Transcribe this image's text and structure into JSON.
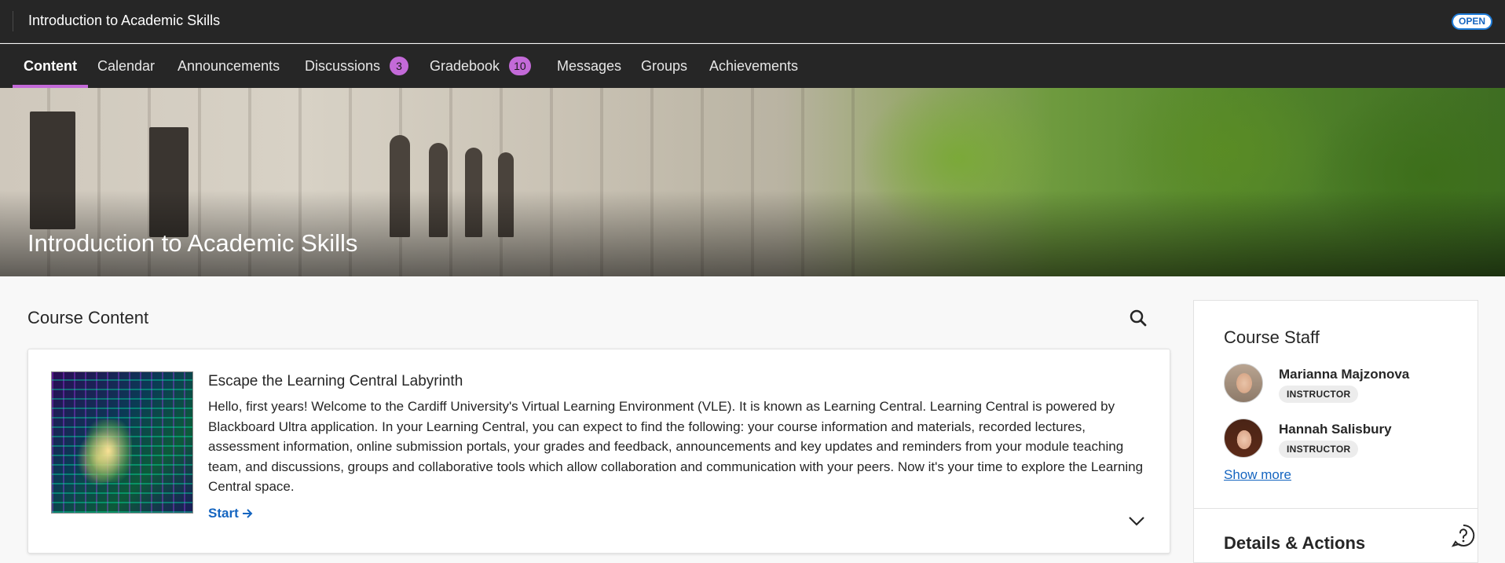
{
  "header": {
    "course_title": "Introduction to Academic Skills",
    "status_badge": "OPEN"
  },
  "nav": {
    "tabs": [
      {
        "label": "Content",
        "active": true
      },
      {
        "label": "Calendar"
      },
      {
        "label": "Announcements"
      },
      {
        "label": "Discussions",
        "badge": "3"
      },
      {
        "label": "Gradebook",
        "badge": "10"
      },
      {
        "label": "Messages"
      },
      {
        "label": "Groups"
      },
      {
        "label": "Achievements"
      }
    ]
  },
  "banner": {
    "title": "Introduction to Academic Skills"
  },
  "main": {
    "section_title": "Course Content",
    "item": {
      "title": "Escape the Learning Central Labyrinth",
      "description": "Hello, first years! Welcome to the Cardiff University's Virtual Learning Environment (VLE). It is known as Learning Central. Learning Central is powered by Blackboard Ultra application. In your Learning Central, you can expect to find the following: your course information and materials, recorded lectures, assessment information, online submission portals, your grades and feedback, announcements and key updates and reminders from your module teaching team, and discussions, groups and collaborative tools which allow collaboration and communication with your peers. Now it's your time to explore the Learning Central space.",
      "start_label": "Start"
    }
  },
  "sidebar": {
    "staff_title": "Course Staff",
    "staff": [
      {
        "name": "Marianna Majzonova",
        "role": "INSTRUCTOR"
      },
      {
        "name": "Hannah Salisbury",
        "role": "INSTRUCTOR"
      }
    ],
    "show_more_label": "Show more",
    "details_title": "Details & Actions"
  },
  "colors": {
    "nav_bg": "#262626",
    "accent_purple": "#c36ad8",
    "link_blue": "#1565c0"
  },
  "icons": [
    "search-icon",
    "chevron-down-icon",
    "arrow-right-icon",
    "help-icon"
  ]
}
